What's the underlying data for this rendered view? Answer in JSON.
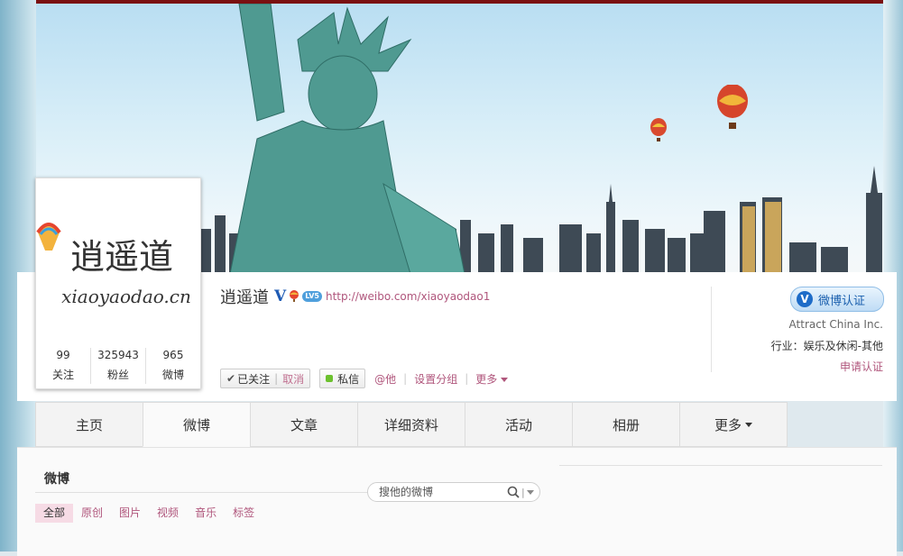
{
  "profile": {
    "name": "逍遥道",
    "level": "LV5",
    "url": "http://weibo.com/xiaoyaodao1",
    "avatar_text": "逍遥道",
    "avatar_sub": "xiaoyaodao.cn",
    "counts": [
      {
        "num": "99",
        "label": "关注"
      },
      {
        "num": "325943",
        "label": "粉丝"
      },
      {
        "num": "965",
        "label": "微博"
      }
    ]
  },
  "actions": {
    "followed": "已关注",
    "cancel": "取消",
    "message": "私信",
    "at": "@他",
    "group": "设置分组",
    "more": "更多"
  },
  "verify": {
    "badge": "微博认证",
    "company": "Attract China Inc.",
    "industry": "行业：娱乐及休闲-其他",
    "apply": "申请认证"
  },
  "tabs": [
    "主页",
    "微博",
    "文章",
    "详细资料",
    "活动",
    "相册",
    "更多"
  ],
  "weibo_section": {
    "title": "微博",
    "search_placeholder": "搜他的微博",
    "filters": [
      "全部",
      "原创",
      "图片",
      "视频",
      "音乐",
      "标签"
    ]
  },
  "colors": {
    "link": "#b0567c",
    "verify_blue": "#1e6cc8",
    "active_filter_bg": "#f6dbe5"
  }
}
